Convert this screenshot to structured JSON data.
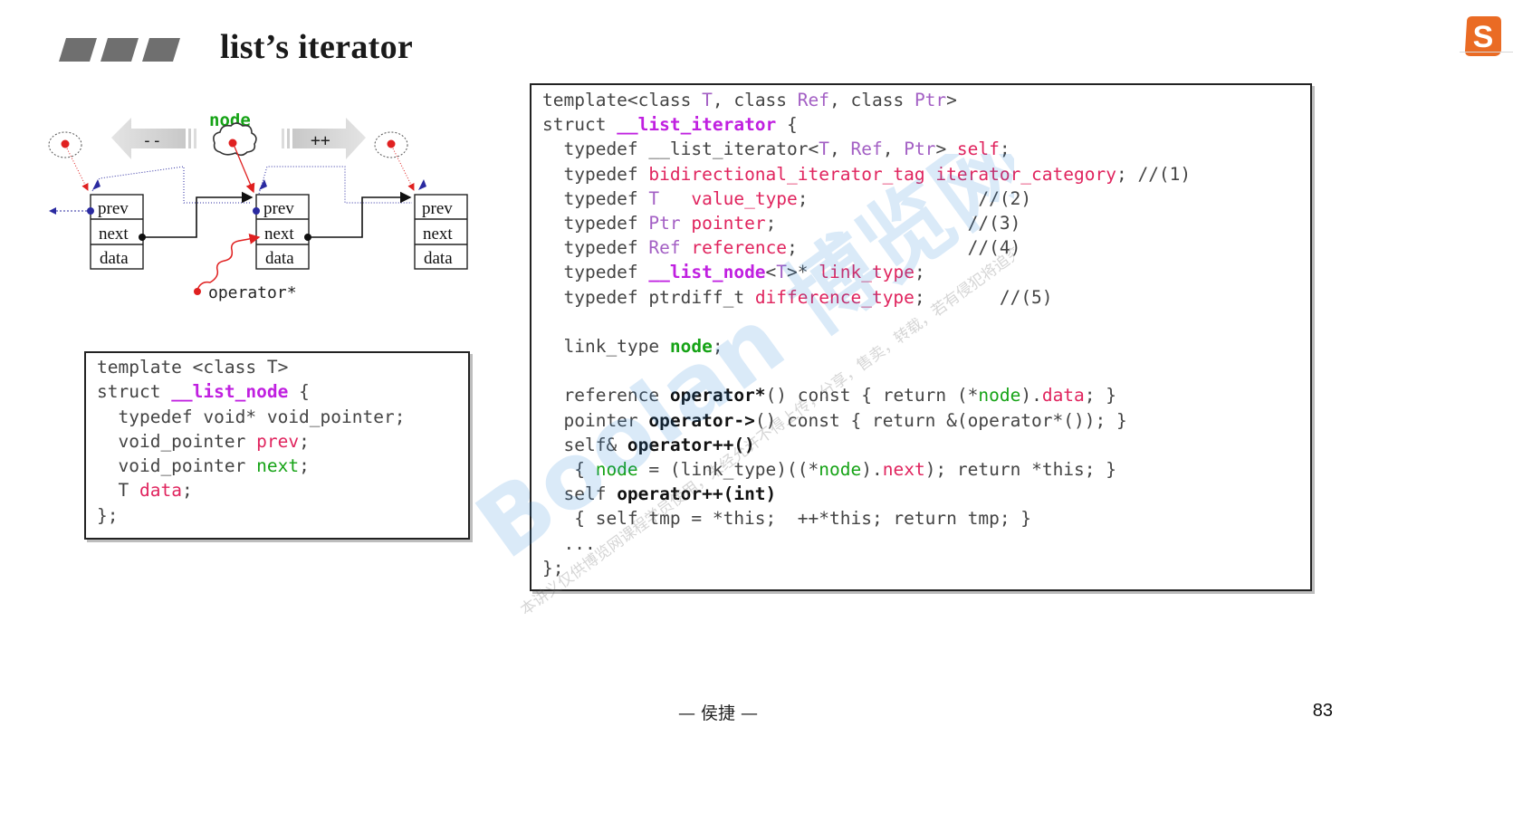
{
  "slide": {
    "title": "list’s iterator",
    "author": "— 侯捷 —",
    "page_number": "83"
  },
  "diagram": {
    "node_label": "node",
    "decrement_label": "--",
    "increment_label": "++",
    "operator_label": "operator*",
    "node_fields": [
      "prev",
      "next",
      "data"
    ]
  },
  "code_left": {
    "lines": [
      [
        [
          "kw",
          "template <class T>"
        ]
      ],
      [
        [
          "kw",
          "struct "
        ],
        [
          "mb",
          "__list_node"
        ],
        [
          "kw",
          " {"
        ]
      ],
      [
        [
          "kw",
          "  typedef void* void_pointer;"
        ]
      ],
      [
        [
          "kw",
          "  void_pointer "
        ],
        [
          "rd",
          "prev"
        ],
        [
          "kw",
          ";"
        ]
      ],
      [
        [
          "kw",
          "  void_pointer "
        ],
        [
          "gr",
          "next"
        ],
        [
          "kw",
          ";"
        ]
      ],
      [
        [
          "kw",
          "  T "
        ],
        [
          "rd",
          "data"
        ],
        [
          "kw",
          ";"
        ]
      ],
      [
        [
          "kw",
          "};"
        ]
      ]
    ]
  },
  "code_right": {
    "lines": [
      [
        [
          "kw",
          "template<class "
        ],
        [
          "pu",
          "T"
        ],
        [
          "kw",
          ", class "
        ],
        [
          "pu",
          "Ref"
        ],
        [
          "kw",
          ", class "
        ],
        [
          "pu",
          "Ptr"
        ],
        [
          "kw",
          ">"
        ]
      ],
      [
        [
          "kw",
          "struct "
        ],
        [
          "mb",
          "__list_iterator"
        ],
        [
          "kw",
          " {"
        ]
      ],
      [
        [
          "kw",
          "  typedef __list_iterator<"
        ],
        [
          "pu",
          "T"
        ],
        [
          "kw",
          ", "
        ],
        [
          "pu",
          "Ref"
        ],
        [
          "kw",
          ", "
        ],
        [
          "pu",
          "Ptr"
        ],
        [
          "kw",
          "> "
        ],
        [
          "rd",
          "self"
        ],
        [
          "kw",
          ";"
        ]
      ],
      [
        [
          "kw",
          "  typedef "
        ],
        [
          "rd",
          "bidirectional_iterator_tag iterator_category"
        ],
        [
          "kw",
          "; //(1)"
        ]
      ],
      [
        [
          "kw",
          "  typedef "
        ],
        [
          "pu",
          "T"
        ],
        [
          "kw",
          "   "
        ],
        [
          "rd",
          "value_type"
        ],
        [
          "kw",
          ";                //(2)"
        ]
      ],
      [
        [
          "kw",
          "  typedef "
        ],
        [
          "pu",
          "Ptr"
        ],
        [
          "kw",
          " "
        ],
        [
          "rd",
          "pointer"
        ],
        [
          "kw",
          ";                  //(3)"
        ]
      ],
      [
        [
          "kw",
          "  typedef "
        ],
        [
          "pu",
          "Ref"
        ],
        [
          "kw",
          " "
        ],
        [
          "rd",
          "reference"
        ],
        [
          "kw",
          ";                //(4)"
        ]
      ],
      [
        [
          "kw",
          "  typedef "
        ],
        [
          "mb",
          "__list_node"
        ],
        [
          "kw",
          "<"
        ],
        [
          "pu",
          "T"
        ],
        [
          "kw",
          ">* "
        ],
        [
          "rd",
          "link_type"
        ],
        [
          "kw",
          ";"
        ]
      ],
      [
        [
          "kw",
          "  typedef ptrdiff_t "
        ],
        [
          "rd",
          "difference_type"
        ],
        [
          "kw",
          ";       //(5)"
        ]
      ],
      [
        [
          "kw",
          ""
        ]
      ],
      [
        [
          "kw",
          "  link_type "
        ],
        [
          "gb",
          "node"
        ],
        [
          "kw",
          ";"
        ]
      ],
      [
        [
          "kw",
          ""
        ]
      ],
      [
        [
          "kw",
          "  reference "
        ],
        [
          "bd",
          "operator*"
        ],
        [
          "kw",
          "() const { return (*"
        ],
        [
          "gr",
          "node"
        ],
        [
          "kw",
          ")."
        ],
        [
          "rd",
          "data"
        ],
        [
          "kw",
          "; }"
        ]
      ],
      [
        [
          "kw",
          "  pointer "
        ],
        [
          "bd",
          "operator->"
        ],
        [
          "kw",
          "() const { return &(operator*()); }"
        ]
      ],
      [
        [
          "kw",
          "  self& "
        ],
        [
          "bd",
          "operator++()"
        ]
      ],
      [
        [
          "kw",
          "   { "
        ],
        [
          "gr",
          "node"
        ],
        [
          "kw",
          " = (link_type)((*"
        ],
        [
          "gr",
          "node"
        ],
        [
          "kw",
          ")."
        ],
        [
          "rd",
          "next"
        ],
        [
          "kw",
          "); return *this; }"
        ]
      ],
      [
        [
          "kw",
          "  self "
        ],
        [
          "bd",
          "operator++(int)"
        ]
      ],
      [
        [
          "kw",
          "   { self tmp = *this;  ++*this; return tmp; }"
        ]
      ],
      [
        [
          "kw",
          "  ..."
        ]
      ],
      [
        [
          "kw",
          "};"
        ]
      ]
    ]
  },
  "watermark": {
    "main_text": "Boolan 博览网",
    "sub_text": "本讲义仅供博览网课程学员使用，未经允许不得上传，分享，售卖，转载，若有侵犯将追究法律责任。"
  },
  "colors": {
    "keyword": "#444444",
    "template_param": "#a35fc4",
    "identifier_red": "#e0245e",
    "identifier_green": "#16a316",
    "struct_name": "#c020e0",
    "logo": "#ea6b24"
  },
  "icons": {
    "logo": "sogou-s-logo-icon",
    "bars": "title-bars-icon"
  }
}
